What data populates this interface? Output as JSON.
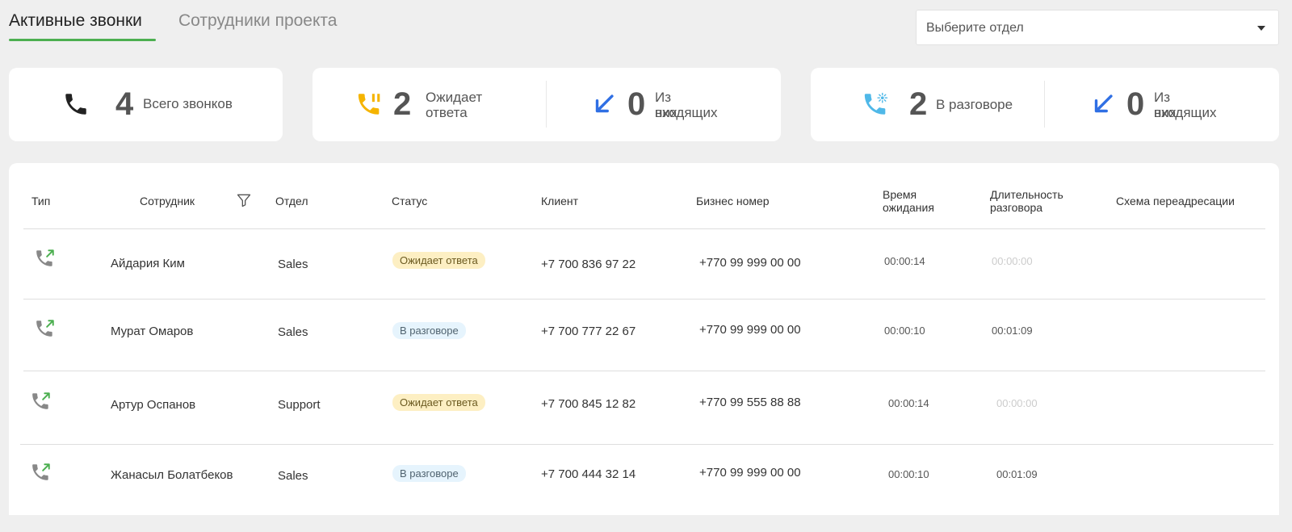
{
  "tabs": {
    "active": "Активные звонки",
    "inactive": "Сотрудники проекта"
  },
  "dept_select": {
    "placeholder": "Выберите отдел"
  },
  "stats": {
    "total": {
      "value": "4",
      "label": "Всего звонков",
      "icon": "phone-icon"
    },
    "waiting": {
      "value": "2",
      "label_line1": "Ожидает",
      "label_line2": "ответа",
      "icon": "phone-hold-icon",
      "color": "#f5b400"
    },
    "waiting_incoming": {
      "value": "0",
      "label_line1": "Из них",
      "label_line2": "входящих",
      "icon": "incoming-arrow-icon",
      "color": "#2f6fe4"
    },
    "talking": {
      "value": "2",
      "label": "В разговоре",
      "icon": "phone-active-icon",
      "color": "#4fb8e8"
    },
    "talking_incoming": {
      "value": "0",
      "label_line1": "Из них",
      "label_line2": "входящих",
      "icon": "incoming-arrow-icon",
      "color": "#2f6fe4"
    }
  },
  "table": {
    "headers": {
      "type": "Тип",
      "employee": "Сотрудник",
      "department": "Отдел",
      "status": "Статус",
      "client": "Клиент",
      "business_number": "Бизнес номер",
      "wait_time_1": "Время",
      "wait_time_2": "ожидания",
      "duration_1": "Длительность",
      "duration_2": "разговора",
      "scheme": "Схема переадресации"
    },
    "rows": [
      {
        "employee": "Айдария Ким",
        "department": "Sales",
        "status": "Ожидает ответа",
        "client": "+7 700 836 97 22",
        "business": "+770 99 999 00 00",
        "wait": "00:00:14",
        "duration": "00:00:00"
      },
      {
        "employee": "Мурат Омаров",
        "department": "Sales",
        "status": "В разговоре",
        "client": "+7 700 777 22 67",
        "business": "+770 99 999 00 00",
        "wait": "00:00:10",
        "duration": "00:01:09"
      },
      {
        "employee": "Артур Оспанов",
        "department": "Support",
        "status": "Ожидает ответа",
        "client": "+7 700 845 12 82",
        "business": "+770 99 555 88 88",
        "wait": "00:00:14",
        "duration": "00:00:00"
      },
      {
        "employee": "Жанасыл Болатбеков",
        "department": "Sales",
        "status": "В разговоре",
        "client": "+7 700 444 32 14",
        "business": "+770 99 999 00 00",
        "wait": "00:00:10",
        "duration": "00:01:09"
      }
    ]
  },
  "colors": {
    "accent": "#4caf50",
    "outgoing_arrow": "#4caf50",
    "muted": "#cccccc"
  }
}
